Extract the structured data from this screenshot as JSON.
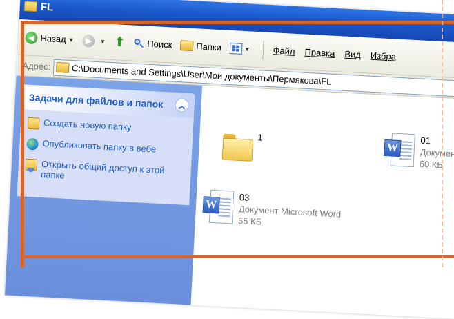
{
  "window": {
    "title": "FL"
  },
  "toolbar": {
    "back_label": "Назад",
    "search_label": "Поиск",
    "folders_label": "Папки"
  },
  "menu": {
    "file": "Файл",
    "edit": "Правка",
    "view": "Вид",
    "favorites": "Избра"
  },
  "address": {
    "label": "Адрес:",
    "path": "C:\\Documents and Settings\\User\\Мои документы\\Пермякова\\FL"
  },
  "tasks": {
    "header": "Задачи для файлов и папок",
    "items": [
      {
        "label": "Создать новую папку",
        "icon": "new-folder-icon"
      },
      {
        "label": "Опубликовать папку в вебе",
        "icon": "globe-icon"
      },
      {
        "label": "Открыть общий доступ к этой папке",
        "icon": "share-folder-icon"
      }
    ]
  },
  "files": [
    {
      "name": "1",
      "type": "",
      "size": "",
      "icon": "folder-icon"
    },
    {
      "name": "01",
      "type": "Документ",
      "size": "60 КБ",
      "icon": "word-document-icon"
    },
    {
      "name": "03",
      "type": "Документ Microsoft Word",
      "size": "55 КБ",
      "icon": "word-document-icon"
    }
  ],
  "colors": {
    "frame_accent": "#d8652a",
    "titlebar_blue": "#1a57c9",
    "task_link_blue": "#215dc6",
    "sidebar_blue": "#7ca2e8"
  }
}
